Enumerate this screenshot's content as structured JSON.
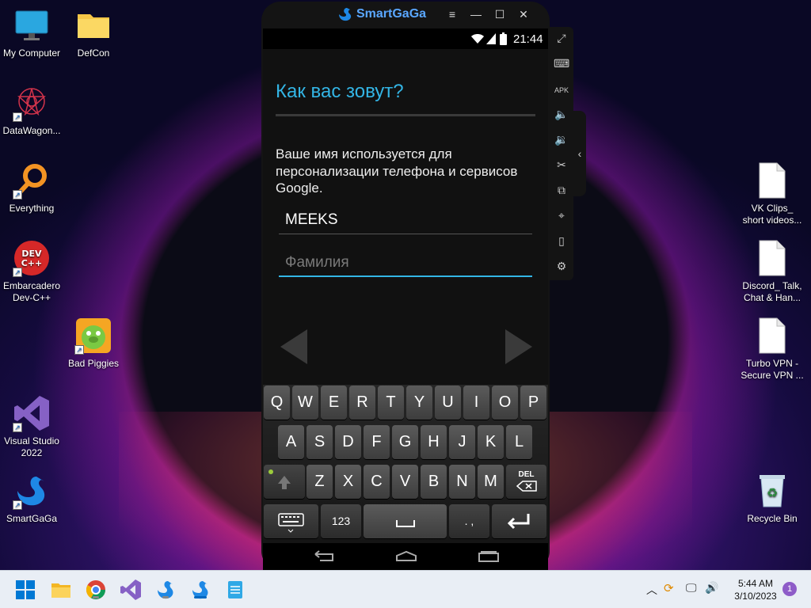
{
  "desktop": {
    "icons": [
      {
        "name": "my-computer",
        "label": "My Computer",
        "icon": "monitor-icon"
      },
      {
        "name": "defcon",
        "label": "DefCon",
        "icon": "folder-icon"
      },
      {
        "name": "datawagon",
        "label": "DataWagon...",
        "icon": "datawagon-icon"
      },
      {
        "name": "everything",
        "label": "Everything",
        "icon": "search-icon"
      },
      {
        "name": "devcpp",
        "label": "Embarcadero Dev-C++",
        "icon": "devcpp-icon",
        "logo_text": "DEV C++"
      },
      {
        "name": "bad-piggies",
        "label": "Bad Piggies",
        "icon": "pig-icon"
      },
      {
        "name": "visual-studio",
        "label": "Visual Studio 2022",
        "icon": "visual-studio-icon"
      },
      {
        "name": "smartgaga",
        "label": "SmartGaGa",
        "icon": "swan-icon"
      },
      {
        "name": "vk-clips",
        "label": "VK Clips_ short videos...",
        "icon": "file-icon"
      },
      {
        "name": "discord",
        "label": "Discord_ Talk, Chat & Han...",
        "icon": "file-icon"
      },
      {
        "name": "turbo-vpn",
        "label": "Turbo VPN - Secure VPN ...",
        "icon": "file-icon"
      },
      {
        "name": "recycle-bin",
        "label": "Recycle Bin",
        "icon": "recycle-bin-icon"
      }
    ]
  },
  "emulator": {
    "title": "SmartGaGa",
    "controls": [
      "menu-icon",
      "minimize-icon",
      "maximize-icon",
      "close-icon"
    ],
    "sidebar_tools": [
      "fullscreen-icon",
      "keyboard-icon",
      "apk-install-icon",
      "volume-up-icon",
      "volume-down-icon",
      "scissors-icon",
      "multi-instance-icon",
      "location-icon",
      "shake-icon",
      "settings-icon"
    ]
  },
  "android": {
    "status": {
      "time": "21:44"
    },
    "heading": "Как вас зовут?",
    "description": "Ваше имя используется для персонализации телефона и сервисов Google.",
    "first_name_value": "MEEKS",
    "last_name_placeholder": "Фамилия",
    "keyboard": {
      "row1": [
        "Q",
        "W",
        "E",
        "R",
        "T",
        "Y",
        "U",
        "I",
        "O",
        "P"
      ],
      "row2": [
        "A",
        "S",
        "D",
        "F",
        "G",
        "H",
        "J",
        "K",
        "L"
      ],
      "row3": [
        "Z",
        "X",
        "C",
        "V",
        "B",
        "N",
        "M"
      ],
      "delete_label": "DEL",
      "numbers_label": "123",
      "punct_label": ". ,"
    }
  },
  "taskbar": {
    "apps": [
      "windows-start-icon",
      "file-explorer-icon",
      "chrome-icon",
      "visual-studio-icon",
      "smartgaga-icon",
      "smartgaga-icon",
      "notepad-icon"
    ],
    "time": "5:44 AM",
    "date": "3/10/2023",
    "notification_count": "1"
  }
}
